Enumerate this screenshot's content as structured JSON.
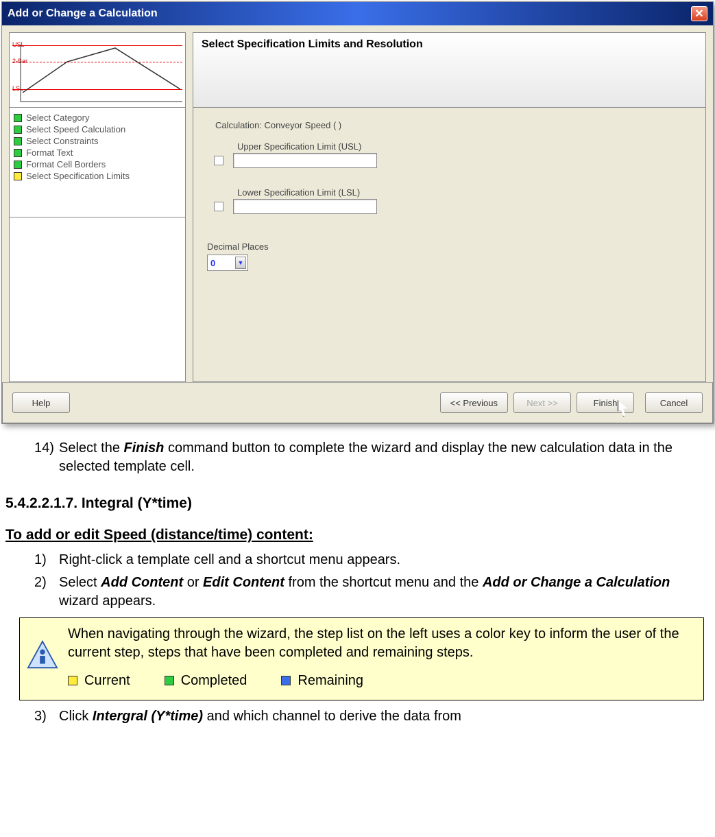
{
  "window": {
    "title": "Add or Change a Calculation",
    "section_title": "Select Specification Limits and Resolution",
    "calc_label": "Calculation: Conveyor Speed ( )",
    "usl_label": "Upper Specification Limit (USL)",
    "lsl_label": "Lower Specification Limit (LSL)",
    "decimal_label": "Decimal Places",
    "decimal_value": "0",
    "steps": [
      {
        "label": "Select Category",
        "state": "green"
      },
      {
        "label": "Select Speed Calculation",
        "state": "green"
      },
      {
        "label": "Select Constraints",
        "state": "green"
      },
      {
        "label": "Format Text",
        "state": "green"
      },
      {
        "label": "Format Cell Borders",
        "state": "green"
      },
      {
        "label": "Select Specification Limits",
        "state": "yellow"
      }
    ],
    "chart_labels": {
      "usl": "USL",
      "lsl": "LSL",
      "mid": "2-Bar"
    },
    "buttons": {
      "help": "Help",
      "previous": "<< Previous",
      "next": "Next >>",
      "finish": "Finish",
      "cancel": "Cancel"
    }
  },
  "doc": {
    "step14_num": "14)",
    "step14_prefix": "Select the ",
    "step14_bold": "Finish",
    "step14_suffix": " command button to complete the wizard and display the new calculation data in the selected template cell.",
    "heading": "5.4.2.2.1.7. Integral (Y*time)",
    "sub_heading": "To add or edit Speed (distance/time) content:",
    "s1_num": "1)",
    "s1_text": "Right-click a template cell and a shortcut menu appears.",
    "s2_num": "2)",
    "s2_prefix": "Select ",
    "s2_b1": "Add Content",
    "s2_mid1": " or ",
    "s2_b2": "Edit Content",
    "s2_mid2": " from the shortcut menu and the ",
    "s2_b3": "Add or Change a Calculation",
    "s2_suffix": " wizard appears.",
    "note_text": "When navigating through the wizard, the step list on the left uses a color key to inform the user of the current step, steps that have been completed and remaining steps.",
    "legend": {
      "current": "Current",
      "completed": "Completed",
      "remaining": "Remaining"
    },
    "s3_num": "3)",
    "s3_prefix": "Click ",
    "s3_bold": "Intergral (Y*time)",
    "s3_suffix": " and which channel to derive the data from"
  }
}
